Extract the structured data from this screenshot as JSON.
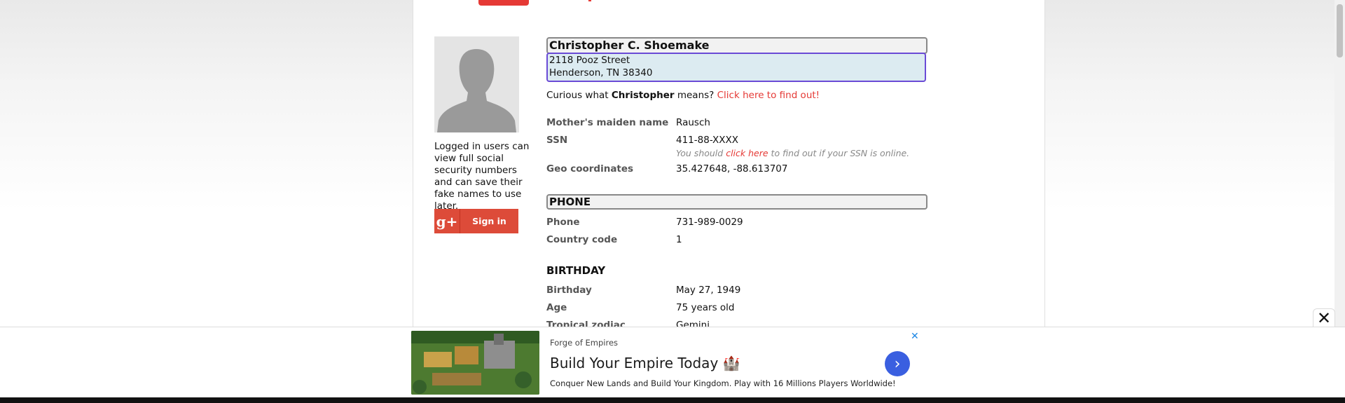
{
  "profile": {
    "full_name": "Christopher C. Shoemake",
    "address_line1": "2118 Pooz Street",
    "address_line2": "Henderson, TN 38340",
    "first_name": "Christopher",
    "curious_prefix": "Curious what",
    "curious_suffix": "means?",
    "curious_link": "Click here to find out!"
  },
  "sidebar": {
    "login_note": "Logged in users can view full social security numbers and can save their fake names to use later.",
    "gplus_icon": "g+",
    "signin_label": "Sign in"
  },
  "details": {
    "mothers_maiden_label": "Mother's maiden name",
    "mothers_maiden_value": "Rausch",
    "ssn_label": "SSN",
    "ssn_value": "411-88-XXXX",
    "ssn_note_prefix": "You should",
    "ssn_note_link": "click here",
    "ssn_note_suffix": "to find out if your SSN is online.",
    "geo_label": "Geo coordinates",
    "geo_value": "35.427648, -88.613707"
  },
  "phone_section": {
    "heading": "PHONE",
    "phone_label": "Phone",
    "phone_value": "731-989-0029",
    "country_code_label": "Country code",
    "country_code_value": "1"
  },
  "birthday_section": {
    "heading": "BIRTHDAY",
    "birthday_label": "Birthday",
    "birthday_value": "May 27, 1949",
    "age_label": "Age",
    "age_value": "75 years old",
    "zodiac_label": "Tropical zodiac",
    "zodiac_value": "Gemini"
  },
  "ad": {
    "brand": "Forge of Empires",
    "title": "Build Your Empire Today 🏰",
    "description": "Conquer New Lands and Build Your Kingdom. Play with 16 Millions Players Worldwide!",
    "close_x": "✕",
    "collapse_x": "✕",
    "arrow": "›"
  },
  "colors": {
    "accent": "#e53935",
    "gplus": "#dd4b39",
    "address_bg": "#dcebf1",
    "address_border": "#6a4bd6",
    "ad_button": "#3a5fe0"
  }
}
